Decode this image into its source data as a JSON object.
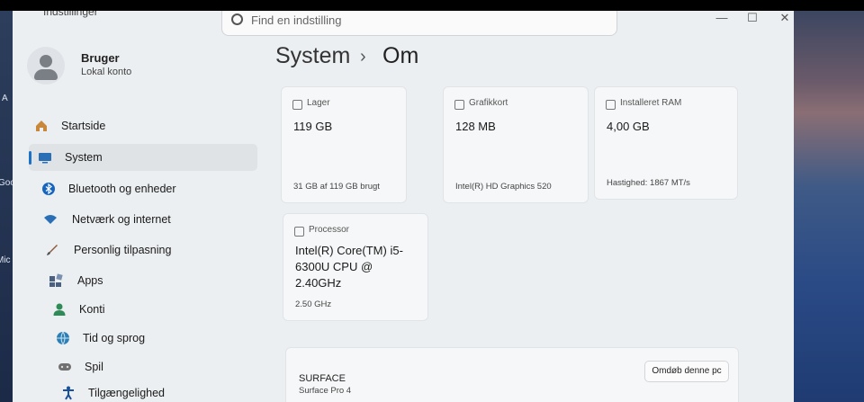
{
  "window": {
    "title": "Indstillinger",
    "search_placeholder": "Find en indstilling",
    "minimize": "—",
    "maximize": "☐",
    "close": "✕"
  },
  "desktop": {
    "left_labels": [
      "A",
      "Goo",
      "Mic"
    ]
  },
  "user": {
    "name": "Bruger",
    "account": "Lokal konto"
  },
  "nav": [
    {
      "label": "Startside",
      "icon": "home-icon",
      "color": "#c8873a"
    },
    {
      "label": "System",
      "icon": "monitor-icon",
      "color": "#2a6fb5",
      "active": true
    },
    {
      "label": "Bluetooth og enheder",
      "icon": "bluetooth-icon",
      "color": "#1565c0"
    },
    {
      "label": "Netværk og internet",
      "icon": "wifi-icon",
      "color": "#2a6fb5"
    },
    {
      "label": "Personlig tilpasning",
      "icon": "brush-icon",
      "color": "#8a5a3a"
    },
    {
      "label": "Apps",
      "icon": "apps-icon",
      "color": "#4a6080"
    },
    {
      "label": "Konti",
      "icon": "person-icon",
      "color": "#2e8b57"
    },
    {
      "label": "Tid og sprog",
      "icon": "globe-icon",
      "color": "#2a7fb5"
    },
    {
      "label": "Spil",
      "icon": "gamepad-icon",
      "color": "#707070"
    },
    {
      "label": "Tilgængelighed",
      "icon": "accessibility-icon",
      "color": "#1a4f9a"
    }
  ],
  "breadcrumb": {
    "parent": "System",
    "separator": "›",
    "current": "Om"
  },
  "specs": {
    "storage": {
      "title": "Lager",
      "value": "119 GB",
      "sub": "31 GB af 119 GB brugt"
    },
    "graphics": {
      "title": "Grafikkort",
      "value": "128 MB",
      "sub": "Intel(R) HD Graphics 520"
    },
    "ram": {
      "title": "Installeret RAM",
      "value": "4,00 GB",
      "sub": "Hastighed: 1867 MT/s"
    },
    "processor": {
      "title": "Processor",
      "value": "Intel(R) Core(TM) i5-6300U CPU @ 2.40GHz",
      "sub": "2.50 GHz"
    }
  },
  "device": {
    "name": "SURFACE",
    "model": "Surface Pro 4",
    "rename_label": "Omdøb denne pc"
  }
}
